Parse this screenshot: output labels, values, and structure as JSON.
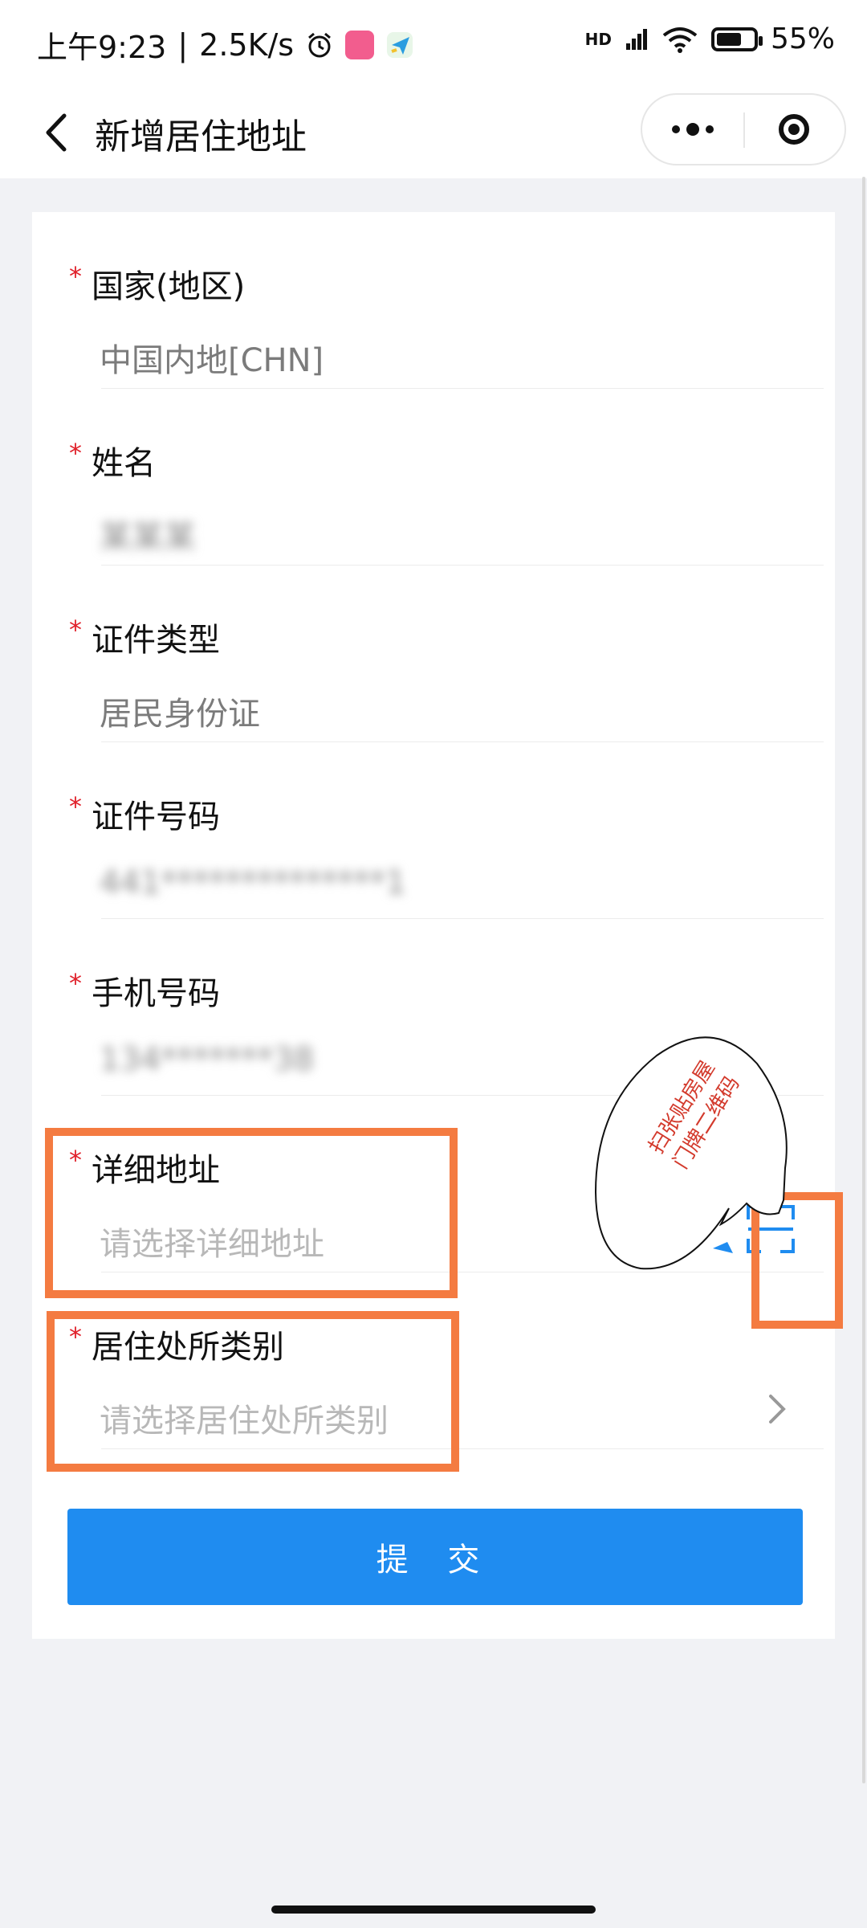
{
  "status": {
    "time": "上午9:23",
    "speed": "2.5K/s",
    "network": "HD",
    "battery": "55%"
  },
  "nav": {
    "title": "新增居住地址"
  },
  "form": {
    "country_label": "国家(地区)",
    "country_value": "中国内地[CHN]",
    "name_label": "姓名",
    "name_value": "某某某",
    "idtype_label": "证件类型",
    "idtype_value": "居民身份证",
    "idno_label": "证件号码",
    "idno_value": "441**************1",
    "phone_label": "手机号码",
    "phone_value": "134*******38",
    "address_label": "详细地址",
    "address_placeholder": "请选择详细地址",
    "residence_label": "居住处所类别",
    "residence_placeholder": "请选择居住处所类别",
    "submit_label": "提 交"
  },
  "annotation": {
    "bubble_text": "扫张贴房屋门牌二维码"
  },
  "colors": {
    "primary": "#1f8cf0",
    "required": "#e0202a",
    "annotation": "#f47b41"
  }
}
